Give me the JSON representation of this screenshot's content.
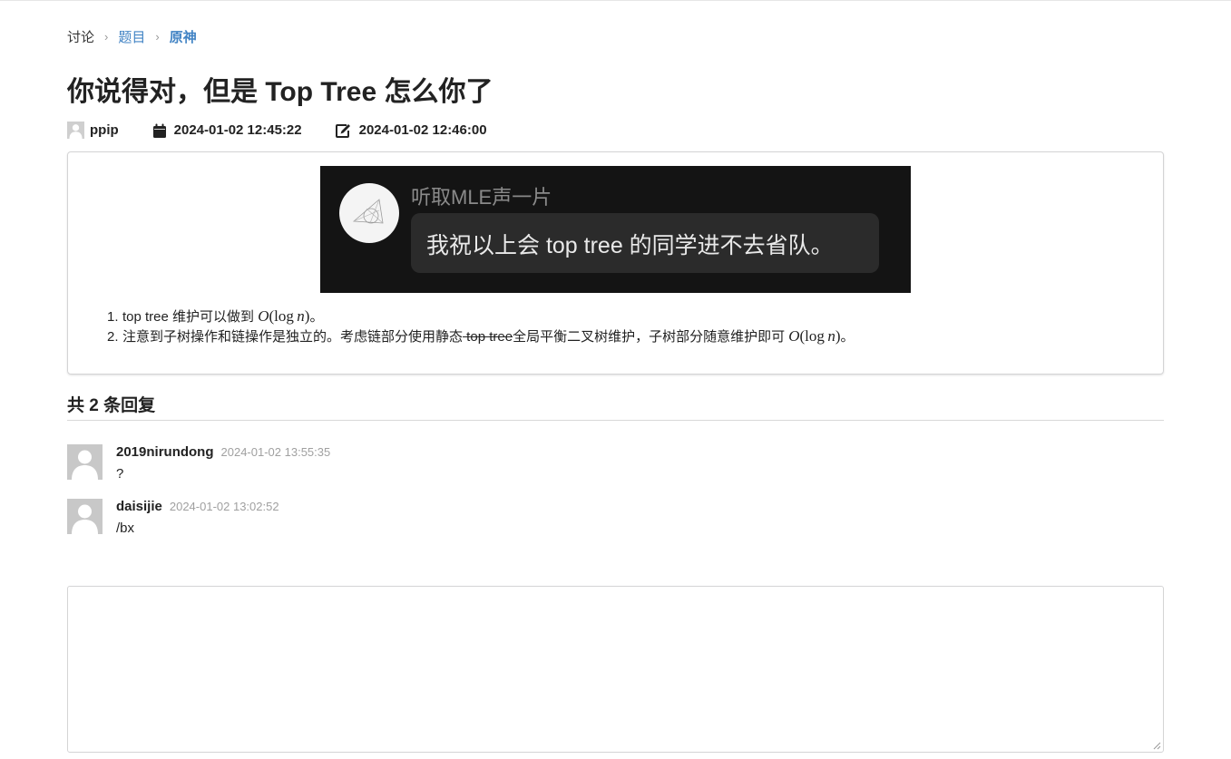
{
  "breadcrumb": {
    "section": "讨论",
    "category": "题目",
    "current": "原神"
  },
  "post": {
    "title": "你说得对，但是 Top Tree 怎么你了",
    "author": "ppip",
    "created": "2024-01-02 12:45:22",
    "edited": "2024-01-02 12:46:00",
    "image": {
      "sender": "听取MLE声一片",
      "message": "我祝以上会 top tree 的同学进不去省队。"
    },
    "items": [
      {
        "num": "1.",
        "text_before": "top tree 维护可以做到 ",
        "math": "O(log n)",
        "text_after": "。"
      },
      {
        "num": "2.",
        "text_before": "注意到子树操作和链操作是独立的。考虑链部分使用静态",
        "struck": " top tree",
        "text_mid": "全局平衡二叉树维护，子树部分随意维护即可 ",
        "math": "O(log n)",
        "text_after": "。"
      }
    ]
  },
  "replies": {
    "header": "共 2 条回复",
    "list": [
      {
        "author": "2019nirundong",
        "time": "2024-01-02 13:55:35",
        "text": "?"
      },
      {
        "author": "daisijie",
        "time": "2024-01-02 13:02:52",
        "text": "/bx"
      }
    ]
  },
  "editor": {
    "value": ""
  },
  "icons": {
    "calendar": "calendar-icon",
    "edit": "edit-icon",
    "avatar": "user-avatar-icon"
  }
}
